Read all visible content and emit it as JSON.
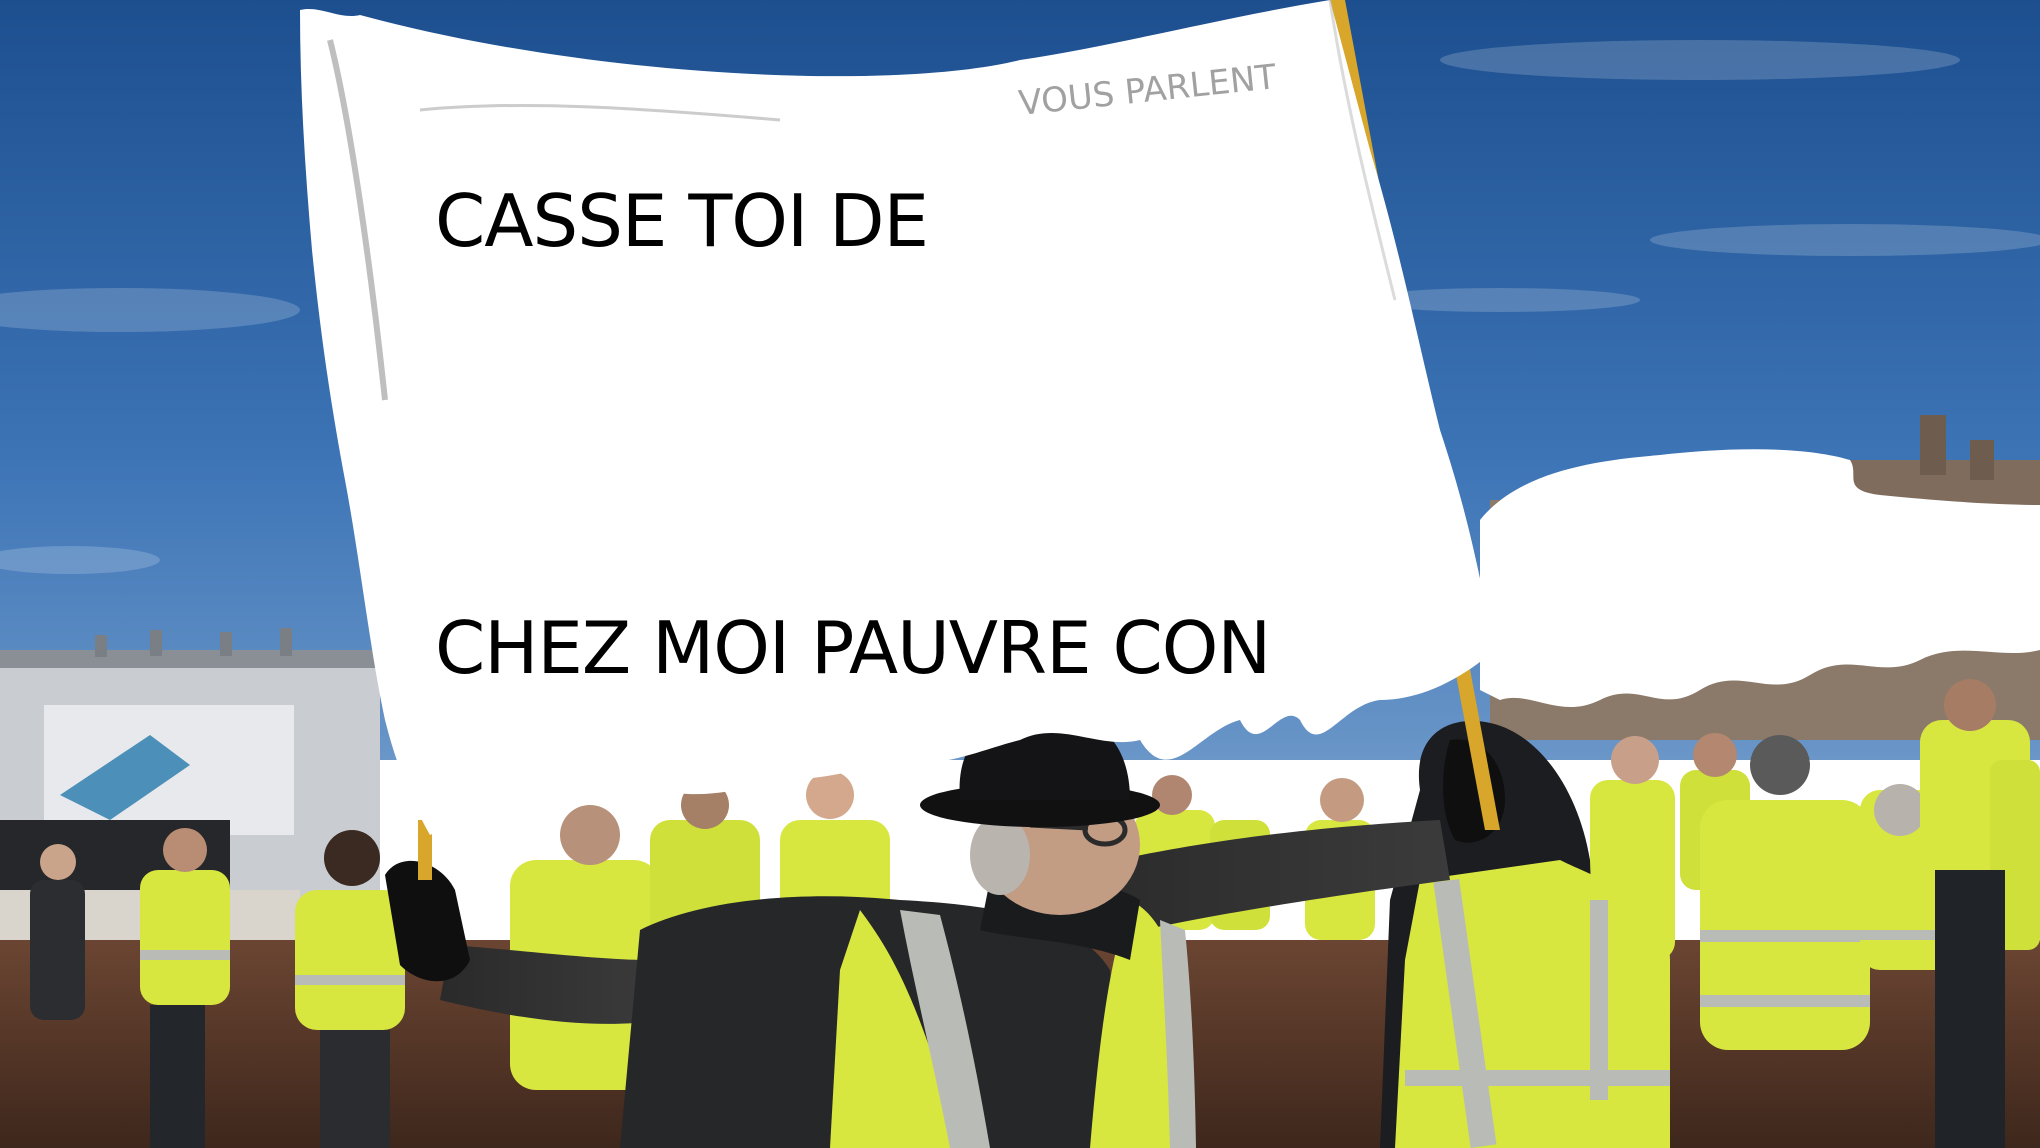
{
  "sign": {
    "line_top": "CASSE TOI DE",
    "line_bottom": "CHEZ MOI PAUVRE CON",
    "faint_handwriting": "VOUS PARLENT"
  },
  "colors": {
    "sky_top": "#1d4f8f",
    "sky_bottom": "#4f86c4",
    "vest_yellow": "#d8e640",
    "reflective_stripe": "#b9bcb6",
    "ground": "#5a3a2a",
    "sign_white": "#ffffff",
    "text": "#000000"
  }
}
